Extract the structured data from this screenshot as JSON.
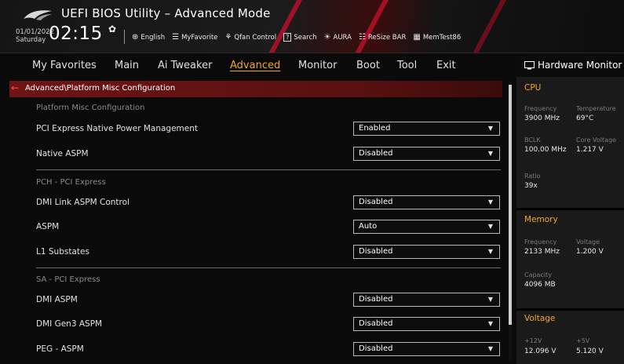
{
  "header": {
    "title": "UEFI BIOS Utility – Advanced Mode",
    "date": "01/01/2022",
    "day": "Saturday",
    "time": "02:15",
    "toolbar": [
      {
        "icon": "globe-icon",
        "glyph": "⊕",
        "label": "English"
      },
      {
        "icon": "myfavorite-icon",
        "glyph": "☰",
        "label": "MyFavorite"
      },
      {
        "icon": "fan-icon",
        "glyph": "⚘",
        "label": "Qfan Control"
      },
      {
        "icon": "search-icon",
        "glyph": "?",
        "label": "Search"
      },
      {
        "icon": "aura-icon",
        "glyph": "☀",
        "label": "AURA"
      },
      {
        "icon": "resize-bar-icon",
        "glyph": "☷",
        "label": "ReSize BAR"
      },
      {
        "icon": "memtest-icon",
        "glyph": "▦",
        "label": "MemTest86"
      }
    ]
  },
  "nav": {
    "items": [
      "My Favorites",
      "Main",
      "Ai Tweaker",
      "Advanced",
      "Monitor",
      "Boot",
      "Tool",
      "Exit"
    ],
    "active": "Advanced"
  },
  "breadcrumb": "Advanced\\Platform Misc Configuration",
  "main": {
    "sections": [
      {
        "title": "Platform Misc Configuration",
        "rows": [
          {
            "label": "PCI Express Native Power Management",
            "value": "Enabled"
          },
          {
            "label": "Native ASPM",
            "value": "Disabled"
          }
        ]
      },
      {
        "title": "PCH - PCI Express",
        "rows": [
          {
            "label": "DMI Link ASPM Control",
            "value": "Disabled"
          },
          {
            "label": "ASPM",
            "value": "Auto"
          },
          {
            "label": "L1 Substates",
            "value": "Disabled"
          }
        ]
      },
      {
        "title": "SA - PCI Express",
        "rows": [
          {
            "label": "DMI ASPM",
            "value": "Disabled"
          },
          {
            "label": "DMI Gen3 ASPM",
            "value": "Disabled"
          },
          {
            "label": "PEG - ASPM",
            "value": "Disabled"
          }
        ]
      }
    ]
  },
  "hardware_monitor": {
    "title": "Hardware Monitor",
    "cpu": {
      "heading": "CPU",
      "frequency_label": "Frequency",
      "frequency": "3900 MHz",
      "temperature_label": "Temperature",
      "temperature": "69°C",
      "bclk_label": "BCLK",
      "bclk": "100.00 MHz",
      "core_voltage_label": "Core Voltage",
      "core_voltage": "1.217 V",
      "ratio_label": "Ratio",
      "ratio": "39x"
    },
    "memory": {
      "heading": "Memory",
      "frequency_label": "Frequency",
      "frequency": "2133 MHz",
      "voltage_label": "Voltage",
      "voltage": "1.200 V",
      "capacity_label": "Capacity",
      "capacity": "4096 MB"
    },
    "voltage": {
      "heading": "Voltage",
      "v12_label": "+12V",
      "v12": "12.096 V",
      "v5_label": "+5V",
      "v5": "5.120 V"
    }
  },
  "colors": {
    "accent": "#f5a623",
    "brand_red": "#c8102e",
    "breadcrumb_bg": "#6e1414"
  }
}
